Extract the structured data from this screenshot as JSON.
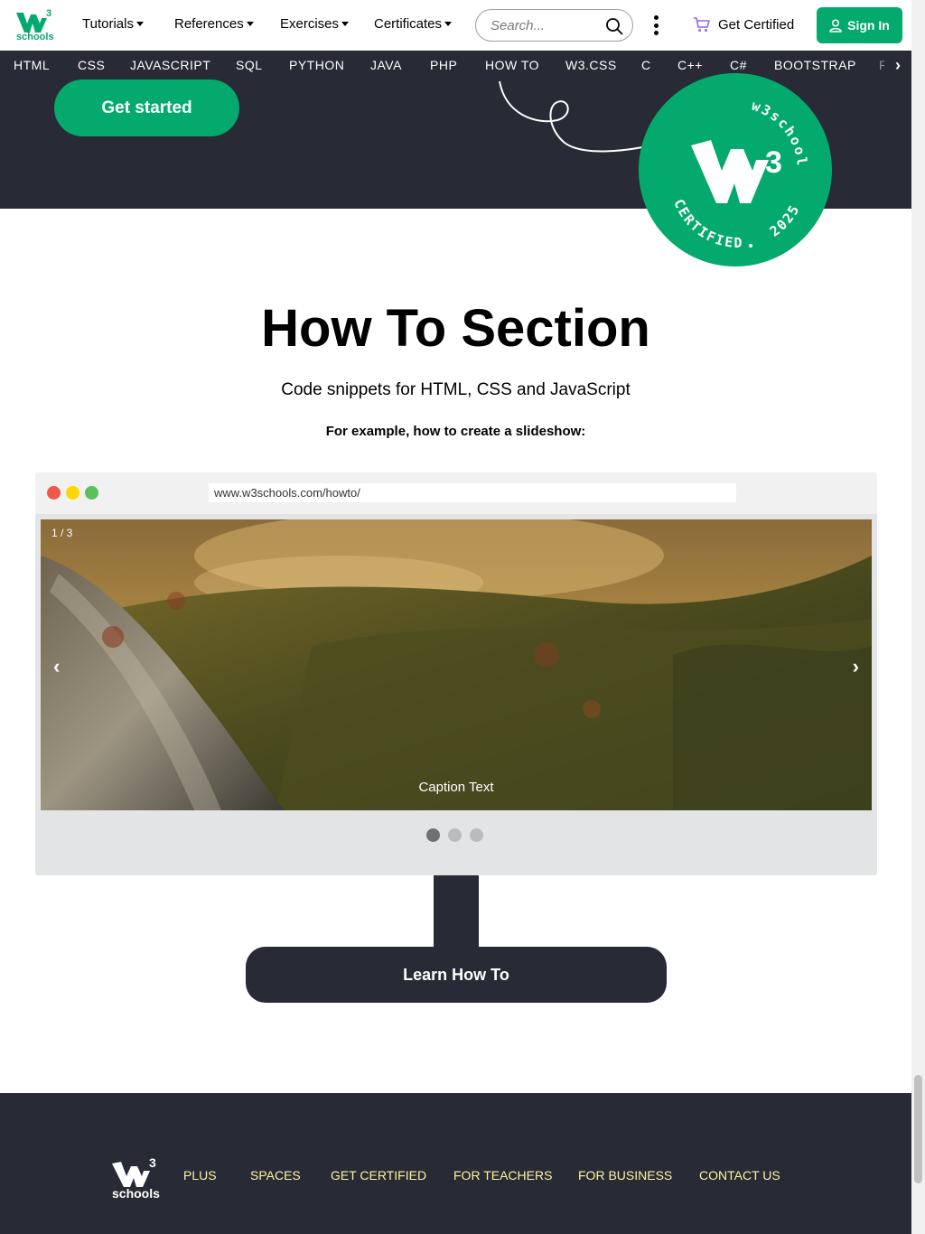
{
  "logo": {
    "text": "schools",
    "superscript": "3",
    "color": "#04AA6D"
  },
  "nav": {
    "menus": [
      "Tutorials",
      "References",
      "Exercises",
      "Certificates"
    ],
    "search_placeholder": "Search...",
    "get_certified": "Get Certified",
    "sign_in": "Sign In"
  },
  "subnav": {
    "items": [
      "HTML",
      "CSS",
      "JAVASCRIPT",
      "SQL",
      "PYTHON",
      "JAVA",
      "PHP",
      "HOW TO",
      "W3.CSS",
      "C",
      "C++",
      "C#",
      "BOOTSTRAP",
      "R"
    ],
    "next_icon": "chevron-right-icon"
  },
  "hero": {
    "get_started": "Get started",
    "badge": {
      "top_text": "w3schools",
      "bottom_text": "CERTIFIED",
      "year": "2025",
      "number": "3"
    }
  },
  "main": {
    "title": "How To Section",
    "subtitle": "Code snippets for HTML, CSS and JavaScript",
    "example_text": "For example, how to create a slideshow:",
    "browser": {
      "url": "www.w3schools.com/howto/",
      "slide_counter": "1 / 3",
      "prev": "‹",
      "next": "›",
      "caption": "Caption Text",
      "dots_total": 3,
      "active_dot": 1
    },
    "learn_button": "Learn How To"
  },
  "footer": {
    "logo_text": "schools",
    "links": [
      "PLUS",
      "SPACES",
      "GET CERTIFIED",
      "FOR TEACHERS",
      "FOR BUSINESS",
      "CONTACT US"
    ]
  },
  "colors": {
    "brand_green": "#04AA6D",
    "dark": "#282A35",
    "footer_link": "#FFF4A3",
    "dot_red": "#ED594A",
    "dot_yellow": "#FDD800",
    "dot_green": "#5AC05A"
  }
}
